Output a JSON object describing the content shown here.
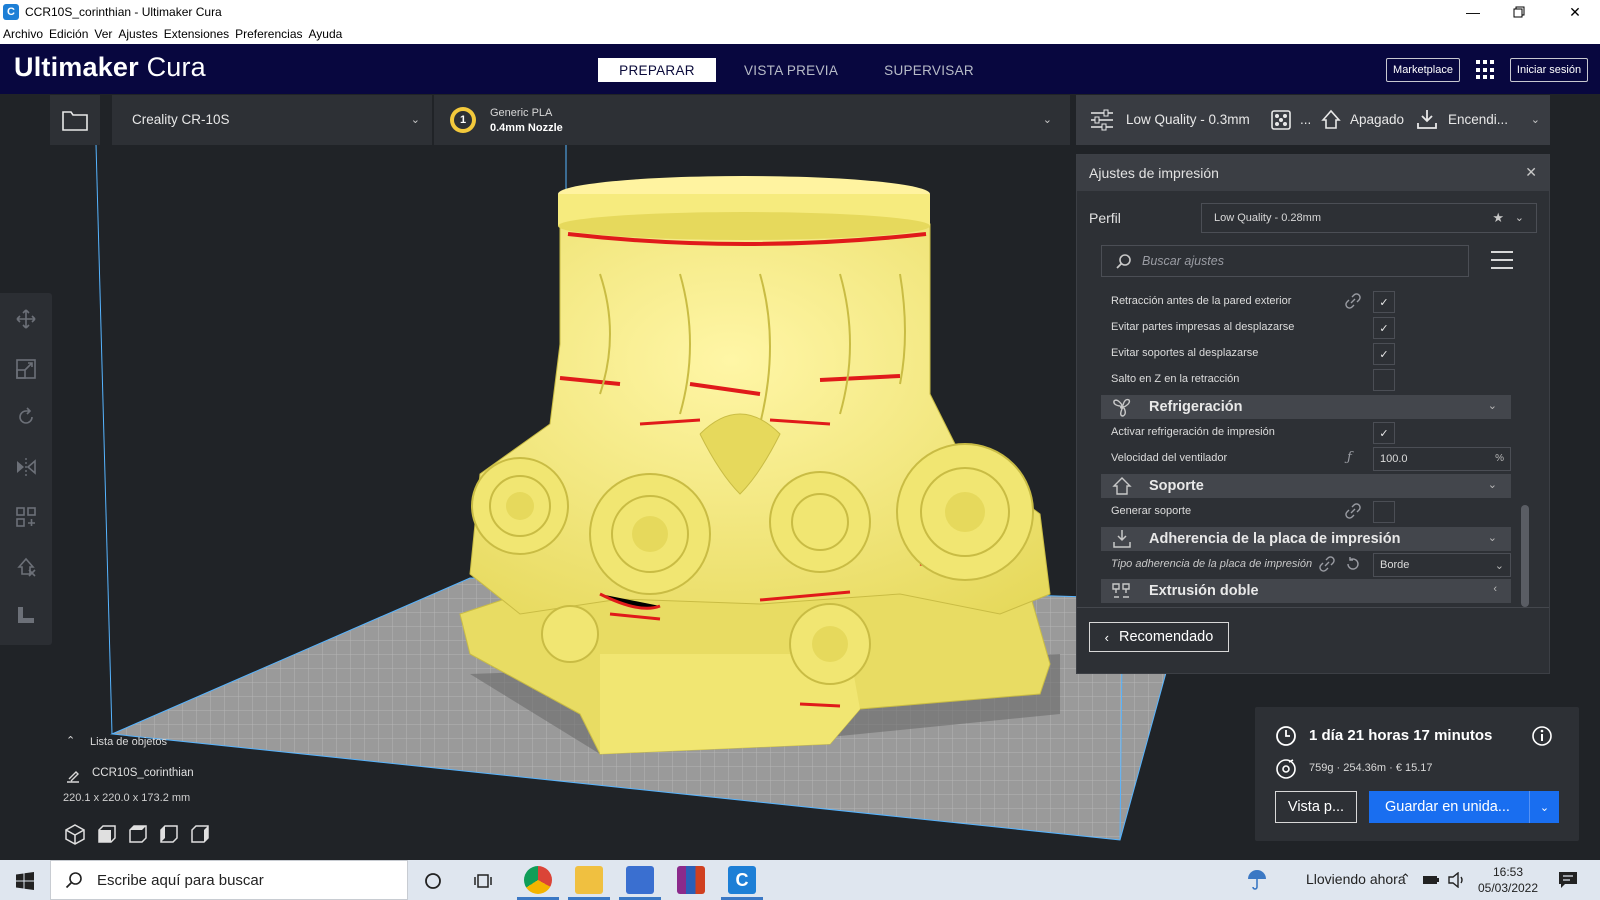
{
  "window": {
    "title": "CCR10S_corinthian - Ultimaker Cura",
    "icon_glyph": "C"
  },
  "menu": [
    "Archivo",
    "Edición",
    "Ver",
    "Ajustes",
    "Extensiones",
    "Preferencias",
    "Ayuda"
  ],
  "header": {
    "logo_bold": "Ultimaker",
    "logo_light": "Cura",
    "tabs": [
      "PREPARAR",
      "VISTA PREVIA",
      "SUPERVISAR"
    ],
    "active_tab": "PREPARAR",
    "marketplace": "Marketplace",
    "signin": "Iniciar sesión"
  },
  "printer": {
    "name": "Creality CR-10S",
    "extruder_number": "1",
    "material": "Generic PLA",
    "nozzle": "0.4mm Nozzle",
    "quality": "Low Quality - 0.3mm",
    "infill": "...",
    "support": "Apagado",
    "adhesion": "Encendi..."
  },
  "settings_panel": {
    "title": "Ajustes de impresión",
    "profile_label": "Perfil",
    "profile_value": "Low Quality - 0.28mm",
    "search_placeholder": "Buscar ajustes",
    "rows": {
      "r1": "Retracción antes de la pared exterior",
      "r2": "Evitar partes impresas al desplazarse",
      "r3": "Evitar soportes al desplazarse",
      "r4": "Salto en Z en la retracción",
      "cat_cooling": "Refrigeración",
      "r5": "Activar refrigeración de impresión",
      "r6": "Velocidad del ventilador",
      "fan_value": "100.0",
      "fan_unit": "%",
      "cat_support": "Soporte",
      "r7": "Generar soporte",
      "cat_adhesion": "Adherencia de la placa de impresión",
      "r8": "Tipo adherencia de la placa de impresión",
      "adhesion_value": "Borde",
      "cat_dual": "Extrusión doble"
    },
    "recommended": "Recomendado"
  },
  "print_info": {
    "time": "1 día 21 horas 17 minutos",
    "material": "759g · 254.36m · € 15.17",
    "preview_btn": "Vista p...",
    "save_btn": "Guardar en unida..."
  },
  "object_list": {
    "title": "Lista de objetos",
    "object_name": "CCR10S_corinthian",
    "dimensions": "220.1 x 220.0 x 173.2 mm"
  },
  "taskbar": {
    "search_placeholder": "Escribe aquí para buscar",
    "weather": "Lloviendo ahora",
    "time": "16:53",
    "date": "05/03/2022"
  },
  "colors": {
    "header": "#08073f",
    "model": "#f3ea7d",
    "overhang": "#e01a1a",
    "accent_blue": "#196ef0"
  }
}
